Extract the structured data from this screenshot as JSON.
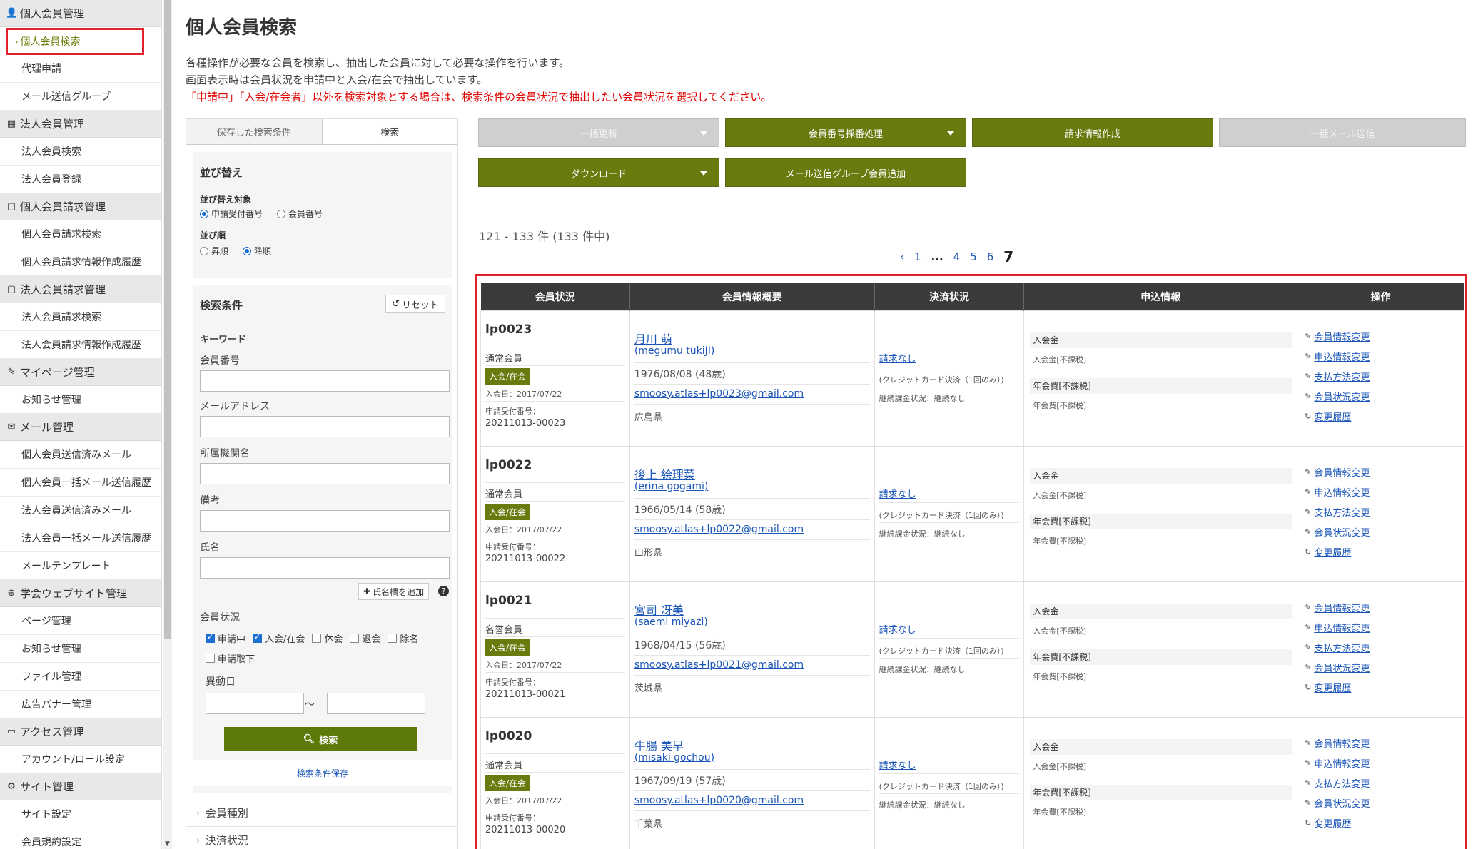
{
  "sidebar": {
    "sections": [
      {
        "icon": "person-icon",
        "glyph": "👤",
        "label": "個人会員管理",
        "items": [
          "個人会員検索",
          "代理申請",
          "メール送信グループ"
        ]
      },
      {
        "icon": "building-icon",
        "glyph": "▦",
        "label": "法人会員管理",
        "items": [
          "法人会員検索",
          "法人会員登録"
        ]
      },
      {
        "icon": "document-icon",
        "glyph": "▢",
        "label": "個人会員請求管理",
        "items": [
          "個人会員請求検索",
          "個人会員請求情報作成履歴"
        ]
      },
      {
        "icon": "document-icon",
        "glyph": "▢",
        "label": "法人会員請求管理",
        "items": [
          "法人会員請求検索",
          "法人会員請求情報作成履歴"
        ]
      },
      {
        "icon": "pencil-icon",
        "glyph": "✎",
        "label": "マイページ管理",
        "items": [
          "お知らせ管理"
        ]
      },
      {
        "icon": "mail-icon",
        "glyph": "✉",
        "label": "メール管理",
        "items": [
          "個人会員送信済みメール",
          "個人会員一括メール送信履歴",
          "法人会員送信済みメール",
          "法人会員一括メール送信履歴",
          "メールテンプレート"
        ]
      },
      {
        "icon": "globe-icon",
        "glyph": "⊕",
        "label": "学会ウェブサイト管理",
        "items": [
          "ページ管理",
          "お知らせ管理",
          "ファイル管理",
          "広告バナー管理"
        ]
      },
      {
        "icon": "monitor-icon",
        "glyph": "▭",
        "label": "アクセス管理",
        "items": [
          "アカウント/ロール設定"
        ]
      },
      {
        "icon": "gear-icon",
        "glyph": "⚙",
        "label": "サイト管理",
        "items": [
          "サイト設定",
          "会員規約設定"
        ]
      }
    ]
  },
  "page": {
    "title": "個人会員検索",
    "desc1": "各種操作が必要な会員を検索し、抽出した会員に対して必要な操作を行います。",
    "desc2": "画面表示時は会員状況を申請中と入会/在会で抽出しています。",
    "desc3": "「申請中」「入会/在会者」以外を検索対象とする場合は、検索条件の会員状況で抽出したい会員状況を選択してください。"
  },
  "panel": {
    "tab_saved": "保存した検索条件",
    "tab_search": "検索",
    "sort_title": "並び替え",
    "sort_target_label": "並び替え対象",
    "sort_target_opt1": "申請受付番号",
    "sort_target_opt2": "会員番号",
    "sort_order_label": "並び順",
    "sort_order_asc": "昇順",
    "sort_order_desc": "降順",
    "criteria_title": "検索条件",
    "reset": "リセット",
    "keyword": "キーワード",
    "member_no": "会員番号",
    "email": "メールアドレス",
    "org": "所属機関名",
    "note": "備考",
    "name": "氏名",
    "add_name": "氏名欄を追加",
    "status_label": "会員状況",
    "st_applying": "申請中",
    "st_active": "入会/在会",
    "st_leave": "休会",
    "st_withdraw": "退会",
    "st_removed": "除名",
    "st_cancel": "申請取下",
    "change_date": "異動日",
    "tilde": "～",
    "search_btn": "検索",
    "save_cond": "検索条件保存",
    "collapse1": "会員種別",
    "collapse2": "決済状況"
  },
  "actions": {
    "bulk_update": "一括更新",
    "numbering": "会員番号採番処理",
    "billing": "請求情報作成",
    "bulk_mail": "一括メール送信",
    "download": "ダウンロード",
    "add_group": "メール送信グループ会員追加"
  },
  "results": {
    "count": "121 - 133 件 (133 件中)",
    "pager": {
      "prev": "‹",
      "p1": "1",
      "dots": "...",
      "p4": "4",
      "p5": "5",
      "p6": "6",
      "current": "7"
    }
  },
  "table": {
    "headers": [
      "会員状況",
      "会員情報概要",
      "決済状況",
      "申込情報",
      "操作"
    ],
    "rows": [
      {
        "id": "lp0023",
        "type": "通常会員",
        "status": "入会/在会",
        "join": "入会日：2017/07/22",
        "app_label": "申請受付番号：",
        "app_no": "20211013-00023",
        "name": "月川 萌",
        "romaji": "(megumu tukiJI)",
        "dob": "1976/08/08 (48歳)",
        "email": "smoosy.atlas+lp0023@gmail.com",
        "pref": "広島県"
      },
      {
        "id": "lp0022",
        "type": "通常会員",
        "status": "入会/在会",
        "join": "入会日：2017/07/22",
        "app_label": "申請受付番号：",
        "app_no": "20211013-00022",
        "name": "後上 絵理菜",
        "romaji": "(erina gogami)",
        "dob": "1966/05/14 (58歳)",
        "email": "smoosy.atlas+lp0022@gmail.com",
        "pref": "山形県"
      },
      {
        "id": "lp0021",
        "type": "名誉会員",
        "status": "入会/在会",
        "join": "入会日：2017/07/22",
        "app_label": "申請受付番号：",
        "app_no": "20211013-00021",
        "name": "宮司 冴美",
        "romaji": "(saemi miyazi)",
        "dob": "1968/04/15 (56歳)",
        "email": "smoosy.atlas+lp0021@gmail.com",
        "pref": "茨城県"
      },
      {
        "id": "lp0020",
        "type": "通常会員",
        "status": "入会/在会",
        "join": "入会日：2017/07/22",
        "app_label": "申請受付番号：",
        "app_no": "20211013-00020",
        "name": "牛腸 美早",
        "romaji": "(misaki gochou)",
        "dob": "1967/09/19 (57歳)",
        "email": "smoosy.atlas+lp0020@gmail.com",
        "pref": "千葉県"
      }
    ],
    "payment": {
      "link": "請求なし",
      "method": "(クレジットカード決済（1回のみ）)",
      "renew": "継続課金状況：継続なし"
    },
    "apply": {
      "fee1": "入会金",
      "fee1_sub": "入会金[不課税]",
      "fee2": "年会費[不課税]",
      "fee2_sub": "年会費[不課税]"
    },
    "ops": [
      "会員情報変更",
      "申込情報変更",
      "支払方法変更",
      "会員状況変更",
      "変更履歴"
    ]
  }
}
